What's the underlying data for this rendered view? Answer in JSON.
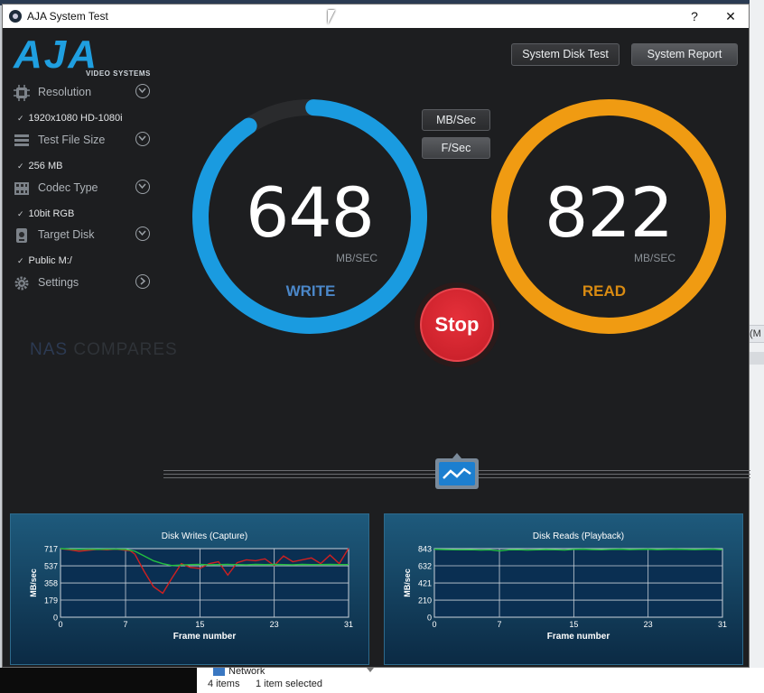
{
  "window": {
    "title": "AJA System Test",
    "help_label": "?",
    "close_label": "✕"
  },
  "logo": {
    "text": "AJA",
    "subtitle": "VIDEO SYSTEMS"
  },
  "sidebar": {
    "items": [
      {
        "label": "Resolution",
        "value": "1920x1080 HD-1080i",
        "icon": "resolution-icon"
      },
      {
        "label": "Test File Size",
        "value": "256 MB",
        "icon": "file-size-icon"
      },
      {
        "label": "Codec Type",
        "value": "10bit RGB",
        "icon": "codec-icon"
      },
      {
        "label": "Target Disk",
        "value": "Public M:/",
        "icon": "disk-icon"
      },
      {
        "label": "Settings",
        "value": "",
        "icon": "gear-icon"
      }
    ],
    "check_glyph": "✓"
  },
  "watermark": {
    "part1": "NAS",
    "part2": "COMPARES"
  },
  "toolbar": {
    "disk_test_label": "System Disk Test",
    "report_label": "System Report"
  },
  "units": {
    "mbsec_label": "MB/Sec",
    "fsec_label": "F/Sec"
  },
  "gauges": {
    "write": {
      "value": "648",
      "unit": "MB/SEC",
      "label": "WRITE",
      "fill_fraction": 0.9,
      "color": "#1a9be0"
    },
    "read": {
      "value": "822",
      "unit": "MB/SEC",
      "label": "READ",
      "fill_fraction": 1.0,
      "color": "#f09b12"
    }
  },
  "stop_label": "Stop",
  "explorer": {
    "network": "Network",
    "items": "4 items",
    "selected": "1 item selected"
  },
  "chart_data": [
    {
      "type": "line",
      "title": "Disk Writes (Capture)",
      "xlabel": "Frame number",
      "ylabel": "MB/sec",
      "xticks": [
        0,
        7,
        15,
        23,
        31
      ],
      "yticks": [
        0,
        179,
        358,
        537,
        717
      ],
      "xlim": [
        0,
        31
      ],
      "ylim": [
        0,
        717
      ],
      "grid": true,
      "series": [
        {
          "color": "#d02020",
          "x": [
            0,
            1,
            2,
            3,
            4,
            5,
            6,
            7,
            7.5,
            8,
            9,
            10,
            11,
            12,
            13,
            14,
            15,
            16,
            17,
            18,
            19,
            20,
            21,
            22,
            23,
            24,
            25,
            26,
            27,
            28,
            29,
            30,
            31
          ],
          "y": [
            717,
            705,
            690,
            700,
            710,
            705,
            712,
            700,
            695,
            660,
            480,
            320,
            250,
            410,
            560,
            520,
            510,
            560,
            580,
            440,
            570,
            600,
            590,
            610,
            540,
            640,
            580,
            600,
            620,
            560,
            650,
            560,
            720
          ]
        },
        {
          "color": "#22c040",
          "x": [
            0,
            1,
            2,
            3,
            4,
            5,
            6,
            7,
            8,
            9,
            10,
            11,
            12,
            13,
            14,
            15,
            16,
            17,
            18,
            19,
            20,
            21,
            22,
            23,
            24,
            25,
            26,
            27,
            28,
            29,
            30,
            31
          ],
          "y": [
            717,
            712,
            710,
            712,
            710,
            712,
            712,
            710,
            690,
            640,
            590,
            560,
            540,
            545,
            550,
            552,
            548,
            550,
            552,
            550,
            548,
            552,
            550,
            552,
            550,
            548,
            552,
            550,
            550,
            552,
            550,
            550
          ]
        }
      ]
    },
    {
      "type": "line",
      "title": "Disk Reads (Playback)",
      "xlabel": "Frame number",
      "ylabel": "MB/sec",
      "xticks": [
        0,
        7,
        15,
        23,
        31
      ],
      "yticks": [
        0,
        210,
        421,
        632,
        843
      ],
      "xlim": [
        0,
        31
      ],
      "ylim": [
        0,
        843
      ],
      "grid": true,
      "series": [
        {
          "color": "#22c040",
          "x": [
            0,
            1,
            2,
            3,
            4,
            5,
            6,
            7,
            8,
            9,
            10,
            11,
            12,
            13,
            14,
            15,
            16,
            17,
            18,
            19,
            20,
            21,
            22,
            23,
            24,
            25,
            26,
            27,
            28,
            29,
            30,
            31
          ],
          "y": [
            835,
            832,
            830,
            828,
            830,
            826,
            828,
            815,
            828,
            830,
            826,
            828,
            832,
            830,
            826,
            834,
            836,
            832,
            830,
            834,
            836,
            832,
            834,
            836,
            832,
            834,
            836,
            834,
            832,
            834,
            836,
            830
          ]
        }
      ]
    }
  ]
}
